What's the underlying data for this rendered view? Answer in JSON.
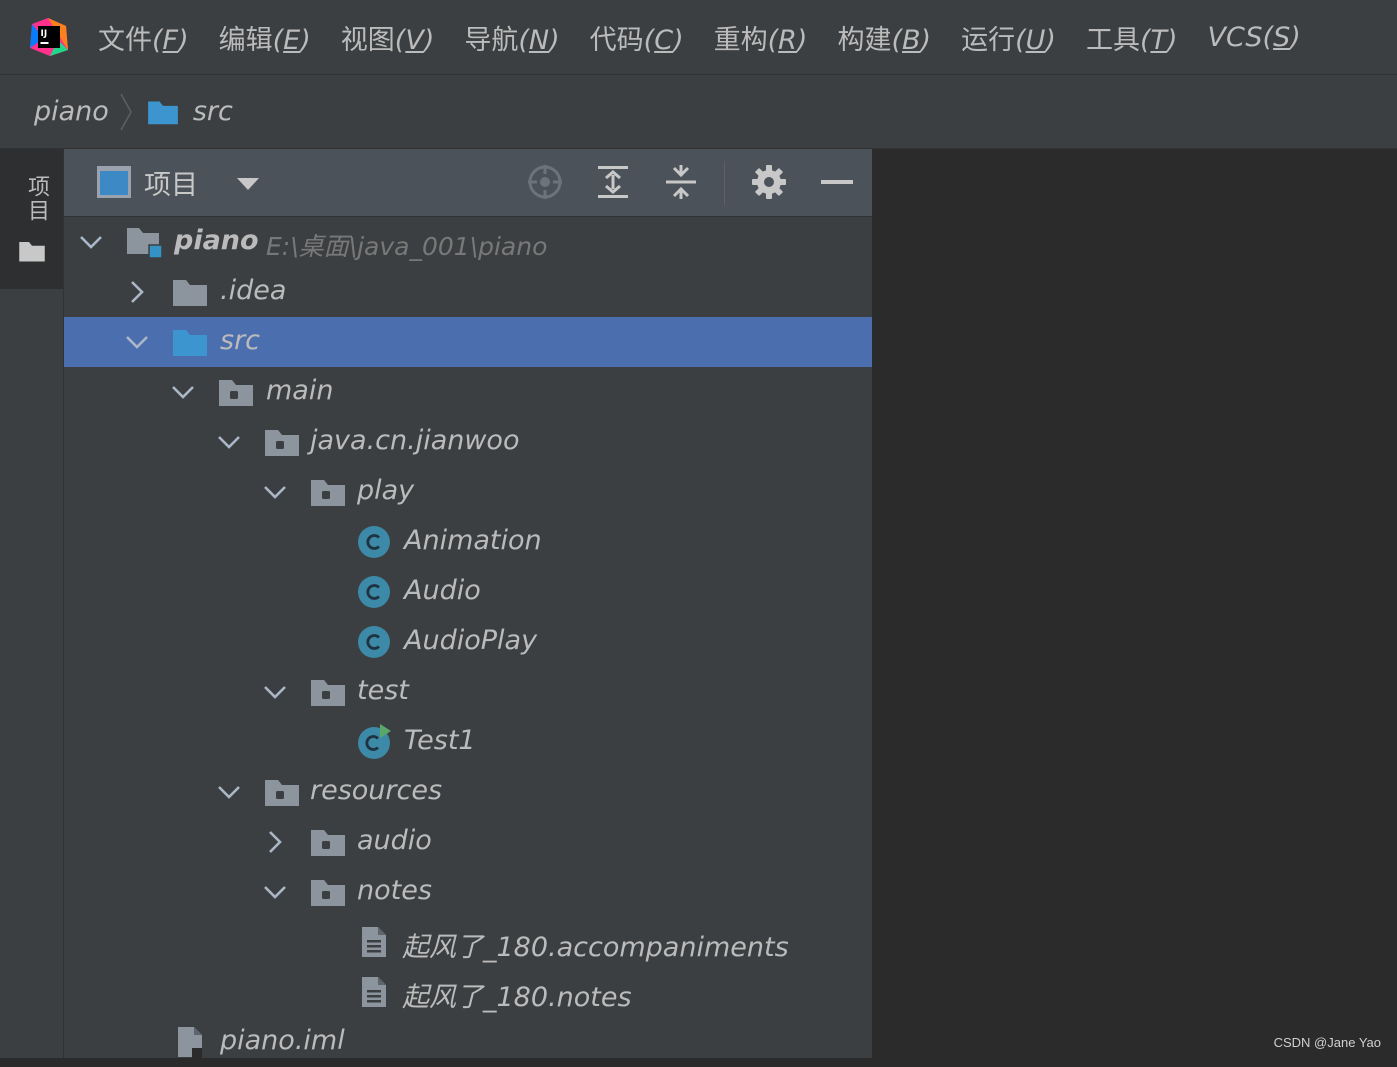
{
  "menubar": {
    "items": [
      {
        "name": "文件",
        "mnemonic": "F"
      },
      {
        "name": "编辑",
        "mnemonic": "E"
      },
      {
        "name": "视图",
        "mnemonic": "V"
      },
      {
        "name": "导航",
        "mnemonic": "N"
      },
      {
        "name": "代码",
        "mnemonic": "C"
      },
      {
        "name": "重构",
        "mnemonic": "R"
      },
      {
        "name": "构建",
        "mnemonic": "B"
      },
      {
        "name": "运行",
        "mnemonic": "U"
      },
      {
        "name": "工具",
        "mnemonic": "T"
      },
      {
        "name": "VCS",
        "mnemonic": "S"
      }
    ]
  },
  "breadcrumb": {
    "root": "piano",
    "current": "src"
  },
  "side_stripe": {
    "label": "项目"
  },
  "project_panel": {
    "view_label": "项目"
  },
  "tree": {
    "rows": [
      {
        "label": "piano",
        "path": "E:\\桌面\\java_001\\piano"
      },
      {
        "label": ".idea"
      },
      {
        "label": "src"
      },
      {
        "label": "main"
      },
      {
        "label": "java.cn.jianwoo"
      },
      {
        "label": "play"
      },
      {
        "label": "Animation"
      },
      {
        "label": "Audio"
      },
      {
        "label": "AudioPlay"
      },
      {
        "label": "test"
      },
      {
        "label": "Test1"
      },
      {
        "label": "resources"
      },
      {
        "label": "audio"
      },
      {
        "label": "notes"
      },
      {
        "label": "起风了_180.accompaniments"
      },
      {
        "label": "起风了_180.notes"
      },
      {
        "label": "piano.iml"
      }
    ]
  },
  "watermark": "CSDN @Jane Yao"
}
